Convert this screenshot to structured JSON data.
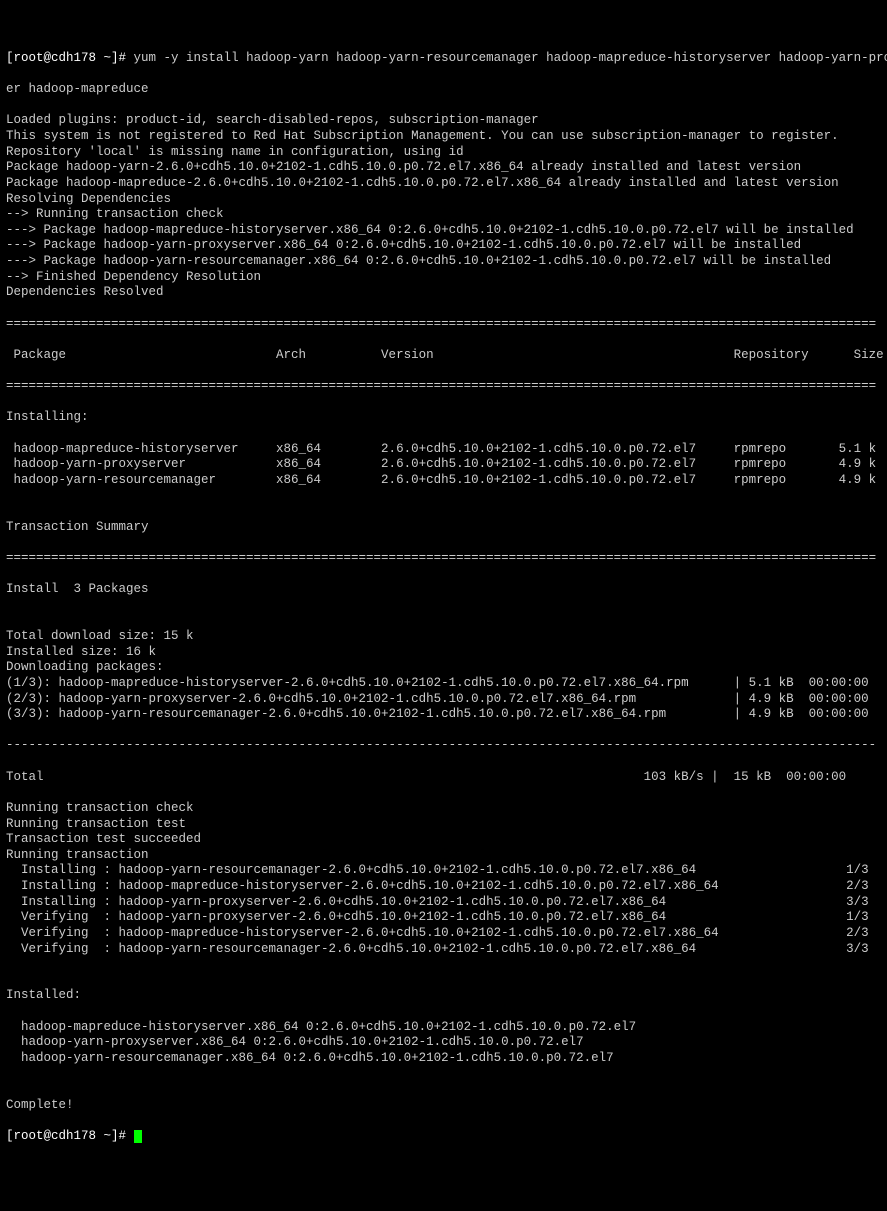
{
  "prompt": {
    "user_host": "[root@cdh178 ~]#",
    "command": "yum -y install hadoop-yarn hadoop-yarn-resourcemanager hadoop-mapreduce-historyserver hadoop-yarn-proxyserv",
    "command_wrap": "er hadoop-mapreduce"
  },
  "pre_lines": [
    "Loaded plugins: product-id, search-disabled-repos, subscription-manager",
    "This system is not registered to Red Hat Subscription Management. You can use subscription-manager to register.",
    "Repository 'local' is missing name in configuration, using id",
    "Package hadoop-yarn-2.6.0+cdh5.10.0+2102-1.cdh5.10.0.p0.72.el7.x86_64 already installed and latest version",
    "Package hadoop-mapreduce-2.6.0+cdh5.10.0+2102-1.cdh5.10.0.p0.72.el7.x86_64 already installed and latest version",
    "Resolving Dependencies",
    "--> Running transaction check",
    "---> Package hadoop-mapreduce-historyserver.x86_64 0:2.6.0+cdh5.10.0+2102-1.cdh5.10.0.p0.72.el7 will be installed",
    "---> Package hadoop-yarn-proxyserver.x86_64 0:2.6.0+cdh5.10.0+2102-1.cdh5.10.0.p0.72.el7 will be installed",
    "---> Package hadoop-yarn-resourcemanager.x86_64 0:2.6.0+cdh5.10.0+2102-1.cdh5.10.0.p0.72.el7 will be installed",
    "--> Finished Dependency Resolution",
    "",
    "Dependencies Resolved",
    ""
  ],
  "divider_eq": "====================================================================================================================",
  "header": " Package                            Arch          Version                                        Repository      Size",
  "installing_label": "Installing:",
  "pkg_rows": [
    " hadoop-mapreduce-historyserver     x86_64        2.6.0+cdh5.10.0+2102-1.cdh5.10.0.p0.72.el7     rpmrepo       5.1 k",
    " hadoop-yarn-proxyserver            x86_64        2.6.0+cdh5.10.0+2102-1.cdh5.10.0.p0.72.el7     rpmrepo       4.9 k",
    " hadoop-yarn-resourcemanager        x86_64        2.6.0+cdh5.10.0+2102-1.cdh5.10.0.p0.72.el7     rpmrepo       4.9 k"
  ],
  "tx_summary": "Transaction Summary",
  "divider_dash": "--------------------------------------------------------------------------------------------------------------------",
  "install_count": "Install  3 Packages",
  "dl_lines": [
    "Total download size: 15 k",
    "Installed size: 16 k",
    "Downloading packages:",
    "(1/3): hadoop-mapreduce-historyserver-2.6.0+cdh5.10.0+2102-1.cdh5.10.0.p0.72.el7.x86_64.rpm      | 5.1 kB  00:00:00",
    "(2/3): hadoop-yarn-proxyserver-2.6.0+cdh5.10.0+2102-1.cdh5.10.0.p0.72.el7.x86_64.rpm             | 4.9 kB  00:00:00",
    "(3/3): hadoop-yarn-resourcemanager-2.6.0+cdh5.10.0+2102-1.cdh5.10.0.p0.72.el7.x86_64.rpm         | 4.9 kB  00:00:00"
  ],
  "total_line": "Total                                                                                103 kB/s |  15 kB  00:00:00",
  "tx_lines": [
    "Running transaction check",
    "Running transaction test",
    "Transaction test succeeded",
    "Running transaction",
    "  Installing : hadoop-yarn-resourcemanager-2.6.0+cdh5.10.0+2102-1.cdh5.10.0.p0.72.el7.x86_64                    1/3",
    "  Installing : hadoop-mapreduce-historyserver-2.6.0+cdh5.10.0+2102-1.cdh5.10.0.p0.72.el7.x86_64                 2/3",
    "  Installing : hadoop-yarn-proxyserver-2.6.0+cdh5.10.0+2102-1.cdh5.10.0.p0.72.el7.x86_64                        3/3",
    "  Verifying  : hadoop-yarn-proxyserver-2.6.0+cdh5.10.0+2102-1.cdh5.10.0.p0.72.el7.x86_64                        1/3",
    "  Verifying  : hadoop-mapreduce-historyserver-2.6.0+cdh5.10.0+2102-1.cdh5.10.0.p0.72.el7.x86_64                 2/3",
    "  Verifying  : hadoop-yarn-resourcemanager-2.6.0+cdh5.10.0+2102-1.cdh5.10.0.p0.72.el7.x86_64                    3/3"
  ],
  "installed_label": "Installed:",
  "installed_rows": [
    "  hadoop-mapreduce-historyserver.x86_64 0:2.6.0+cdh5.10.0+2102-1.cdh5.10.0.p0.72.el7",
    "  hadoop-yarn-proxyserver.x86_64 0:2.6.0+cdh5.10.0+2102-1.cdh5.10.0.p0.72.el7",
    "  hadoop-yarn-resourcemanager.x86_64 0:2.6.0+cdh5.10.0+2102-1.cdh5.10.0.p0.72.el7"
  ],
  "complete": "Complete!",
  "prompt2": "[root@cdh178 ~]#"
}
